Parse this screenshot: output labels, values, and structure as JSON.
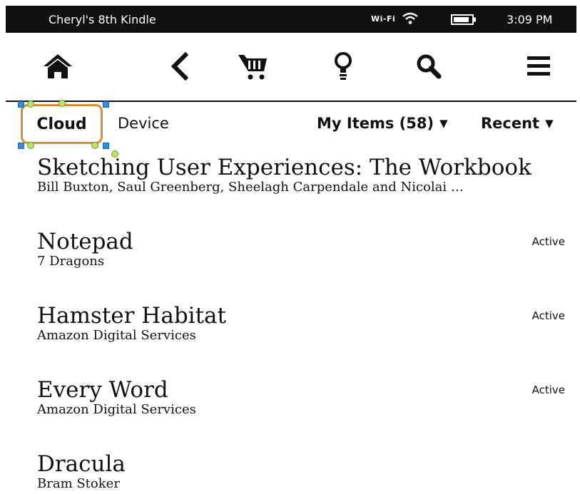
{
  "status": {
    "device_name": "Cheryl's 8th Kindle",
    "wifi_label": "Wi-Fi",
    "time": "3:09 PM"
  },
  "toolbar": {
    "icons": [
      "home-icon",
      "back-icon",
      "cart-icon",
      "lightbulb-icon",
      "search-icon",
      "menu-icon"
    ]
  },
  "filters": {
    "cloud_label": "Cloud",
    "device_label": "Device",
    "items_label": "My Items (58)",
    "sort_label": "Recent",
    "caret": "▼",
    "selection_color": "#e0892e"
  },
  "items": [
    {
      "title": "Sketching User Experiences: The Workbook",
      "author": "Bill Buxton, Saul Greenberg, Sheelagh Carpendale and Nicolai …",
      "badge": ""
    },
    {
      "title": "Notepad",
      "author": "7 Dragons",
      "badge": "Active"
    },
    {
      "title": "Hamster Habitat",
      "author": "Amazon Digital Services",
      "badge": "Active"
    },
    {
      "title": "Every Word",
      "author": "Amazon Digital Services",
      "badge": "Active"
    },
    {
      "title": "Dracula",
      "author": "Bram Stoker",
      "badge": ""
    }
  ]
}
